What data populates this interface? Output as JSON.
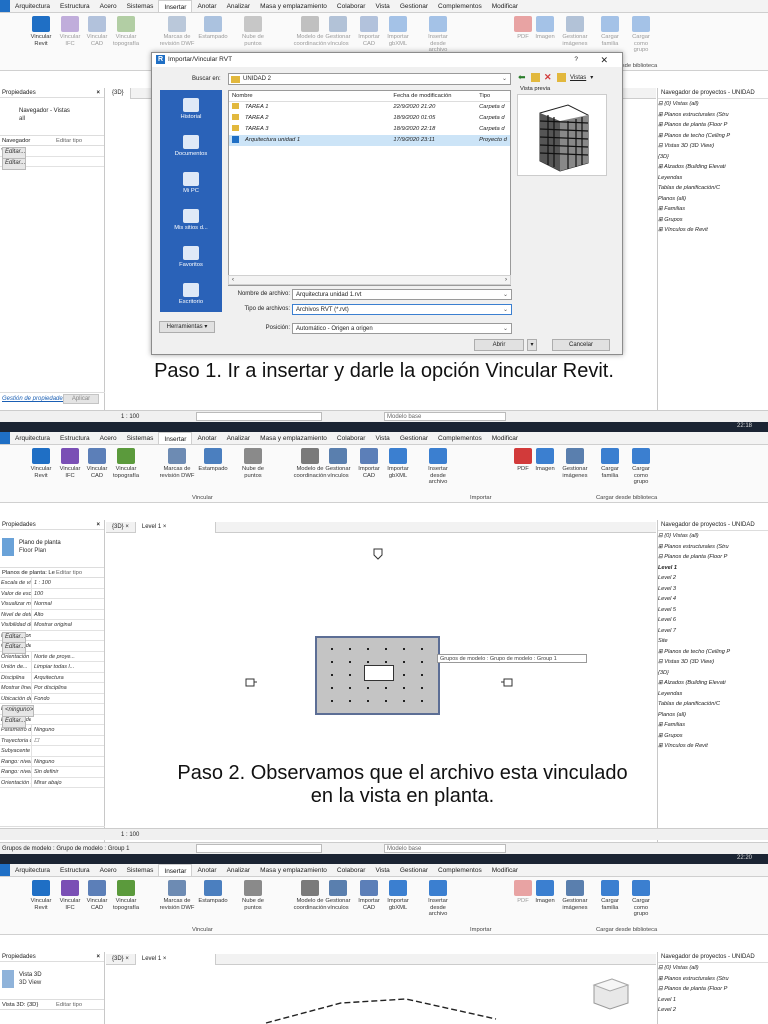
{
  "ribbon": {
    "tabs": [
      "Arquitectura",
      "Estructura",
      "Acero",
      "Sistemas",
      "Insertar",
      "Anotar",
      "Analizar",
      "Masa y emplazamiento",
      "Colaborar",
      "Vista",
      "Gestionar",
      "Complementos",
      "Modificar"
    ],
    "active_tab": "Insertar",
    "buttons": [
      {
        "label": "Vincular Revit",
        "icon": "revit-link-icon",
        "color": "#1f6fc5"
      },
      {
        "label": "Vincular IFC",
        "icon": "ifc-link-icon",
        "color": "#7a4fb5"
      },
      {
        "label": "Vincular CAD",
        "icon": "cad-link-icon",
        "color": "#5c7fb8"
      },
      {
        "label": "Vincular topografía",
        "icon": "topography-icon",
        "color": "#5b9a3c"
      },
      {
        "label": "Marcas de revisión DWF",
        "icon": "dwf-markup-icon",
        "color": "#6d8bb3"
      },
      {
        "label": "Estampado",
        "icon": "decal-icon",
        "color": "#4b7fbf"
      },
      {
        "label": "Nube de puntos",
        "icon": "point-cloud-icon",
        "color": "#8a8a8a"
      },
      {
        "label": "Modelo de coordinación",
        "icon": "coordination-model-icon",
        "color": "#7a7a7a"
      },
      {
        "label": "Gestionar vínculos",
        "icon": "manage-links-icon",
        "color": "#5a7fae"
      },
      {
        "label": "Importar CAD",
        "icon": "import-cad-icon",
        "color": "#5c7fb8"
      },
      {
        "label": "Importar gbXML",
        "icon": "import-gbxml-icon",
        "color": "#3b7fd0"
      },
      {
        "label": "Insertar desde archivo",
        "icon": "insert-from-file-icon",
        "color": "#3b7fd0"
      },
      {
        "label": "PDF",
        "icon": "pdf-icon",
        "color": "#d23a3a"
      },
      {
        "label": "Imagen",
        "icon": "image-icon",
        "color": "#3b7fd0"
      },
      {
        "label": "Gestionar imágenes",
        "icon": "manage-images-icon",
        "color": "#5a7fae"
      },
      {
        "label": "Cargar familia",
        "icon": "load-family-icon",
        "color": "#3b7fd0"
      },
      {
        "label": "Cargar como grupo",
        "icon": "load-group-icon",
        "color": "#3b7fd0"
      }
    ],
    "groups": {
      "vincular": "Vincular",
      "importar": "Importar",
      "biblioteca": "Cargar desde biblioteca"
    }
  },
  "panels": {
    "properties_title": "Propiedades",
    "browser_title": "Navegador de proyectos - UNIDAD",
    "properties_link": "Gestión de propiedades",
    "apply": "Aplicar",
    "edit_type": "Editar tipo",
    "editor_btn": "Editar...",
    "none_btn": "<ninguno>"
  },
  "step1": {
    "type_name": "Navegador - Vistas",
    "type_sub": "all",
    "filter": "Navegador",
    "props": [
      {
        "k": "Vistas",
        "v": "Editar..."
      },
      {
        "k": "",
        "v": "Editar..."
      }
    ],
    "tab": "{3D}",
    "caption": "Paso 1. Ir a insertar y darle la opción Vincular Revit.",
    "status_scale": "1 : 100",
    "status_model": "Modelo base",
    "time": "22:18",
    "browser_tree": [
      "⊟ {0} Vistas (all)",
      "   ⊞ Planos estructurales (Stru",
      "   ⊞ Planos de planta (Floor P",
      "   ⊞ Planos de techo (Ceiling P",
      "   ⊟ Vistas 3D (3D View)",
      "         {3D}",
      "   ⊞ Alzados (Building Elevati",
      "   Leyendas",
      "   Tablas de planificación/C",
      "   Planos (all)",
      "⊞ Familias",
      "⊞ Grupos",
      "⊞ Vínculos de Revit"
    ]
  },
  "dialog": {
    "title": "Importar/Vincular RVT",
    "help": "?",
    "close": "✕",
    "look_in_label": "Buscar en:",
    "look_in_value": "UNIDAD 2",
    "views_label": "Vistas",
    "preview_label": "Vista previa",
    "places": [
      "Historial",
      "Documentos",
      "Mi PC",
      "Mis sitios d...",
      "Favoritos",
      "Escritorio"
    ],
    "columns": [
      "Nombre",
      "Fecha de modificación",
      "Tipo"
    ],
    "files": [
      {
        "name": "TAREA 1",
        "date": "22/9/2020 21:20",
        "type": "Carpeta d"
      },
      {
        "name": "TAREA 2",
        "date": "18/9/2020 01:05",
        "type": "Carpeta d"
      },
      {
        "name": "TAREA 3",
        "date": "18/9/2020 22:18",
        "type": "Carpeta d"
      },
      {
        "name": "Arquitectura unidad 1",
        "date": "17/9/2020 23:11",
        "type": "Proyecto d"
      }
    ],
    "filename_label": "Nombre de archivo:",
    "filename_value": "Arquitectura unidad 1.rvt",
    "filetype_label": "Tipo de archivos:",
    "filetype_value": "Archivos RVT (*.rvt)",
    "position_label": "Posición:",
    "position_value": "Automático - Origen a origen",
    "tools_btn": "Herramientas",
    "open_btn": "Abrir",
    "cancel_btn": "Cancelar"
  },
  "step2": {
    "type_name": "Plano de planta",
    "type_sub": "Floor Plan",
    "filter": "Planos de planta: Le",
    "props": [
      {
        "k": "Escala de vista",
        "v": "1 : 100"
      },
      {
        "k": "Valor de escal...",
        "v": "100"
      },
      {
        "k": "Visualizar mo...",
        "v": "Normal"
      },
      {
        "k": "Nivel de detalle",
        "v": "Alto"
      },
      {
        "k": "Visibilidad de...",
        "v": "Mostrar original"
      },
      {
        "k": "Modificaciones...",
        "v": "Editar..."
      },
      {
        "k": "Opciones de v...",
        "v": "Editar..."
      },
      {
        "k": "Orientación",
        "v": "Norte de proye..."
      },
      {
        "k": "Unión de...",
        "v": "Limpiar todas l..."
      },
      {
        "k": "Disciplina",
        "v": "Arquitectura"
      },
      {
        "k": "Mostrar líneas...",
        "v": "Por disciplina"
      },
      {
        "k": "Ubicación de...",
        "v": "Fondo"
      },
      {
        "k": "Esquema de c...",
        "v": "<ninguno>"
      },
      {
        "k": "Esquema de c...",
        "v": "Editar..."
      },
      {
        "k": "Parámetro defe...",
        "v": "Ninguno"
      },
      {
        "k": "Trayectoria de sol",
        "v": "☐"
      },
      {
        "k": "Subyacente",
        "v": ""
      },
      {
        "k": "Rango: nivel b...",
        "v": "Ninguno"
      },
      {
        "k": "Rango: nivel s...",
        "v": "Sin definir"
      },
      {
        "k": "Orientación s...",
        "v": "Mirar abajo"
      }
    ],
    "tabs": [
      "{3D}",
      "Level 1"
    ],
    "tooltip": "Grupos de modelo : Grupo de modelo : Group 1",
    "caption_line1": "Paso 2. Observamos que el archivo esta vinculado",
    "caption_line2": "en la vista en planta.",
    "status_left": "Grupos de modelo : Grupo de modelo : Group 1",
    "status_scale": "1 : 100",
    "status_model": "Modelo base",
    "time": "22:20",
    "browser_tree": [
      "⊟ {0} Vistas (all)",
      "   ⊞ Planos estructurales (Stru",
      "   ⊟ Planos de planta (Floor P",
      "         Level 1",
      "         Level 2",
      "         Level 3",
      "         Level 4",
      "         Level 5",
      "         Level 6",
      "         Level 7",
      "         Site",
      "   ⊞ Planos de techo (Ceiling P",
      "   ⊟ Vistas 3D (3D View)",
      "         {3D}",
      "   ⊞ Alzados (Building Elevati",
      "   Leyendas",
      "   Tablas de planificación/C",
      "   Planos (all)",
      "⊞ Familias",
      "⊞ Grupos",
      "⊞ Vínculos de Revit"
    ]
  },
  "step3": {
    "type_name": "Vista 3D",
    "type_sub": "3D View",
    "filter": "Vista 3D: {3D}",
    "tabs": [
      "{3D}",
      "Level 1"
    ],
    "browser_tree": [
      "⊟ {0} Vistas (all)",
      "   ⊞ Planos estructurales (Stru",
      "   ⊟ Planos de planta (Floor P",
      "         Level 1",
      "         Level 2"
    ]
  }
}
